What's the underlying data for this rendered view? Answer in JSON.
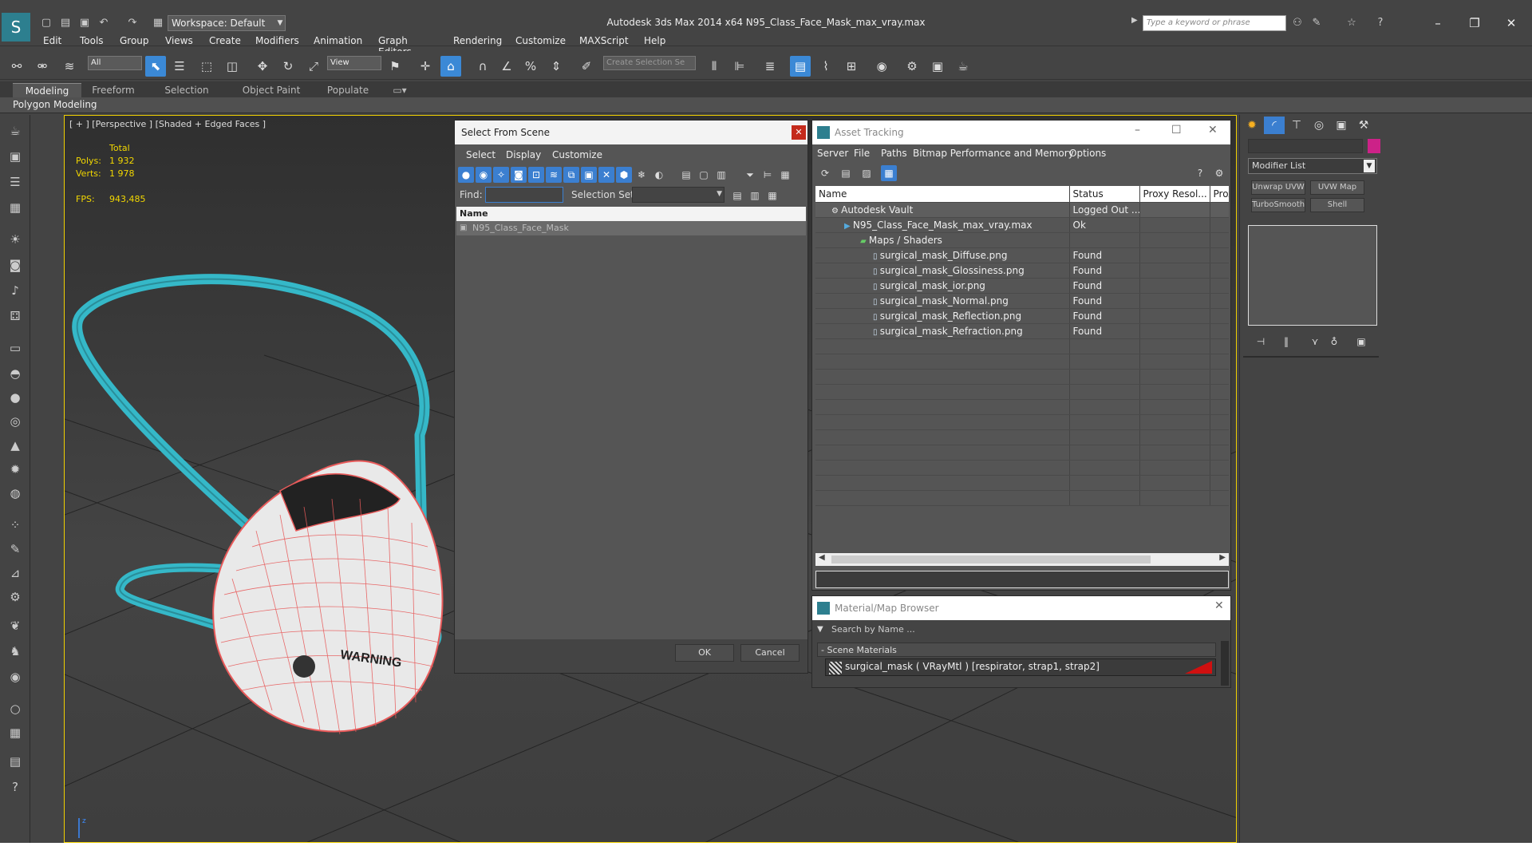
{
  "window": {
    "title": "Autodesk 3ds Max  2014 x64     N95_Class_Face_Mask_max_vray.max",
    "workspace": "Workspace: Default",
    "search_placeholder": "Type a keyword or phrase"
  },
  "menu": [
    "Edit",
    "Tools",
    "Group",
    "Views",
    "Create",
    "Modifiers",
    "Animation",
    "Graph Editors",
    "Rendering",
    "Customize",
    "MAXScript",
    "Help"
  ],
  "toolbar": {
    "filter_value": "All",
    "coord_value": "View",
    "named_selection_placeholder": "Create Selection Se"
  },
  "ribbon": {
    "tabs": [
      "Modeling",
      "Freeform",
      "Selection",
      "Object Paint",
      "Populate"
    ],
    "panel_label": "Polygon Modeling"
  },
  "viewport": {
    "label": "[ + ] [Perspective ] [Shaded + Edged Faces ]",
    "stats": {
      "total_label": "Total",
      "polys_label": "Polys:",
      "polys_value": "1 932",
      "verts_label": "Verts:",
      "verts_value": "1 978",
      "fps_label": "FPS:",
      "fps_value": "943,485"
    },
    "mask_print": "WARNING"
  },
  "select_from_scene": {
    "title": "Select From Scene",
    "menu": [
      "Select",
      "Display",
      "Customize"
    ],
    "find_label": "Find:",
    "selection_set_label": "Selection Set:",
    "column_name": "Name",
    "items": [
      "N95_Class_Face_Mask"
    ],
    "ok": "OK",
    "cancel": "Cancel"
  },
  "asset_tracking": {
    "title": "Asset Tracking",
    "menu": [
      "Server",
      "File",
      "Paths",
      "Bitmap Performance and Memory",
      "Options"
    ],
    "columns": [
      "Name",
      "Status",
      "Proxy Resol...",
      "Prox"
    ],
    "rows": [
      {
        "name": "Autodesk Vault",
        "status": "Logged Out ...",
        "indent": 0
      },
      {
        "name": "N95_Class_Face_Mask_max_vray.max",
        "status": "Ok",
        "indent": 1
      },
      {
        "name": "Maps / Shaders",
        "status": "",
        "indent": 2
      },
      {
        "name": "surgical_mask_Diffuse.png",
        "status": "Found",
        "indent": 3
      },
      {
        "name": "surgical_mask_Glossiness.png",
        "status": "Found",
        "indent": 3
      },
      {
        "name": "surgical_mask_ior.png",
        "status": "Found",
        "indent": 3
      },
      {
        "name": "surgical_mask_Normal.png",
        "status": "Found",
        "indent": 3
      },
      {
        "name": "surgical_mask_Reflection.png",
        "status": "Found",
        "indent": 3
      },
      {
        "name": "surgical_mask_Refraction.png",
        "status": "Found",
        "indent": 3
      }
    ]
  },
  "material_browser": {
    "title": "Material/Map Browser",
    "search_placeholder": "Search by Name ...",
    "group_label": "- Scene Materials",
    "material": "surgical_mask  ( VRayMtl )  [respirator, strap1, strap2]"
  },
  "command_panel": {
    "modifier_list": "Modifier List",
    "buttons": [
      "Unwrap UVW",
      "UVW Map",
      "TurboSmooth",
      "Shell"
    ]
  },
  "colors": {
    "accent": "#3b89d6",
    "viewport_border": "#f0d000",
    "strap": "#35b8c8",
    "wire": "#e85a5a",
    "stats": "#f2d700"
  }
}
